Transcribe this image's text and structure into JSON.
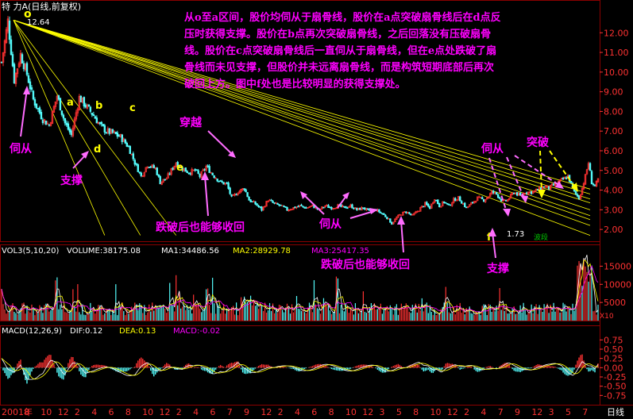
{
  "header": {
    "title": "特 力A(日线,前复权)",
    "high_label": "12.64",
    "low_label": "1.73",
    "signal_label": "波段"
  },
  "annotation": {
    "lines": [
      "从o至a区间，股价均伺从于扇骨线，股价在a点突破扇骨线后在d点反",
      "压时获得支撑。股价在b点再次突破扇骨线，之后回落没有压破扇骨",
      "线。股价在c点突破扇骨线后一直伺从于扇骨线，但在e点处跌破了扇",
      "骨线而未见支撑，但股价并未远离扇骨线，而是构筑短期底部后再次",
      "破回上方。图中f处也是比较明显的获得支撑处。"
    ]
  },
  "callouts": {
    "o": "o",
    "a": "a",
    "b": "b",
    "c": "c",
    "d": "d",
    "e": "e",
    "f": "f",
    "follow1": "伺从",
    "support1": "支撑",
    "cross": "穿越",
    "recover1": "跌破后也能够收回",
    "follow2": "伺从",
    "recover2": "跌破后也能够收回",
    "follow3": "伺从",
    "breakout": "突破",
    "support2": "支撑"
  },
  "colors": {
    "up": "#ff3232",
    "down": "#54fcfc",
    "fan": "#ffff00",
    "grid": "#8b0000",
    "axis_text": "#ff3232",
    "magenta": "#ff00ff",
    "yellow_text": "#ffff00",
    "dif": "#ffffff",
    "dea": "#ffff00",
    "ma1": "#ffffff",
    "ma2": "#ffff00",
    "ma3": "#ff00ff",
    "vol_bar": "#9a9a9a"
  },
  "indicators": {
    "vol": {
      "label": "VOL3(5,10,20)",
      "volume": "VOLUME:38175.08",
      "ma1": "MA1:34486.56",
      "ma2": "MA2:28929.78",
      "ma3": "MA3:25417.35",
      "unit": "X10"
    },
    "macd": {
      "label": "MACD(12,26,9)",
      "dif": "DIF:0.12",
      "dea": "DEA:0.13",
      "macd": "MACD:-0.02"
    }
  },
  "chart_data": [
    {
      "type": "candlestick",
      "title": "特 力A(日线,前复权)",
      "ylim": [
        1.4,
        13.1
      ],
      "yticks": [
        2.0,
        3.0,
        4.0,
        5.0,
        6.0,
        7.0,
        8.0,
        9.0,
        10.0,
        11.0,
        12.0
      ],
      "ytick_labels": [
        "2.00",
        "3.00",
        "4.00",
        "5.00",
        "6.00",
        "7.00",
        "8.00",
        "9.00",
        "10.00",
        "11.00",
        "12.00"
      ],
      "x_bars": 370,
      "close_path": [
        [
          0,
          10.5
        ],
        [
          8,
          12.6
        ],
        [
          16,
          9.6
        ],
        [
          24,
          10.9
        ],
        [
          32,
          9.9
        ],
        [
          40,
          8.6
        ],
        [
          52,
          7.6
        ],
        [
          60,
          7.3
        ],
        [
          70,
          8.8
        ],
        [
          80,
          7.4
        ],
        [
          88,
          6.8
        ],
        [
          98,
          8.7
        ],
        [
          108,
          8.2
        ],
        [
          116,
          7.8
        ],
        [
          124,
          7.3
        ],
        [
          132,
          7.0
        ],
        [
          140,
          6.9
        ],
        [
          150,
          6.7
        ],
        [
          160,
          6.2
        ],
        [
          168,
          5.4
        ],
        [
          176,
          4.7
        ],
        [
          184,
          5.3
        ],
        [
          194,
          5.1
        ],
        [
          200,
          4.4
        ],
        [
          208,
          4.6
        ],
        [
          220,
          5.4
        ],
        [
          228,
          5.1
        ],
        [
          236,
          4.9
        ],
        [
          244,
          5.0
        ],
        [
          250,
          4.7
        ],
        [
          258,
          5.2
        ],
        [
          266,
          4.8
        ],
        [
          276,
          4.4
        ],
        [
          284,
          4.3
        ],
        [
          290,
          3.6
        ],
        [
          298,
          3.9
        ],
        [
          306,
          4.1
        ],
        [
          312,
          3.5
        ],
        [
          320,
          3.3
        ],
        [
          328,
          3.0
        ],
        [
          336,
          3.5
        ],
        [
          344,
          3.3
        ],
        [
          352,
          3.2
        ],
        [
          360,
          3.0
        ],
        [
          368,
          3.1
        ],
        [
          376,
          3.2
        ],
        [
          384,
          3.1
        ],
        [
          392,
          3.2
        ],
        [
          400,
          3.0
        ],
        [
          408,
          3.2
        ],
        [
          416,
          3.1
        ],
        [
          424,
          3.2
        ],
        [
          432,
          3.1
        ],
        [
          440,
          3.2
        ],
        [
          448,
          3.0
        ],
        [
          456,
          3.1
        ],
        [
          464,
          2.9
        ],
        [
          472,
          3.0
        ],
        [
          480,
          2.8
        ],
        [
          486,
          2.6
        ],
        [
          492,
          2.3
        ],
        [
          498,
          2.6
        ],
        [
          504,
          2.8
        ],
        [
          510,
          2.9
        ],
        [
          518,
          2.7
        ],
        [
          526,
          3.0
        ],
        [
          534,
          3.3
        ],
        [
          540,
          3.1
        ],
        [
          546,
          3.6
        ],
        [
          552,
          3.2
        ],
        [
          558,
          3.4
        ],
        [
          564,
          3.2
        ],
        [
          570,
          3.5
        ],
        [
          576,
          3.6
        ],
        [
          580,
          3.4
        ],
        [
          586,
          3.1
        ],
        [
          592,
          3.3
        ],
        [
          600,
          3.6
        ],
        [
          608,
          3.5
        ],
        [
          614,
          3.7
        ],
        [
          618,
          3.9
        ],
        [
          624,
          3.8
        ],
        [
          632,
          3.4
        ],
        [
          638,
          3.5
        ],
        [
          646,
          3.9
        ],
        [
          654,
          3.7
        ],
        [
          660,
          3.9
        ],
        [
          668,
          3.9
        ],
        [
          676,
          4.0
        ],
        [
          684,
          4.2
        ],
        [
          690,
          4.1
        ],
        [
          698,
          4.3
        ],
        [
          706,
          4.5
        ],
        [
          714,
          4.7
        ],
        [
          722,
          3.9
        ],
        [
          728,
          3.6
        ],
        [
          732,
          4.1
        ],
        [
          736,
          4.7
        ],
        [
          740,
          5.4
        ],
        [
          744,
          4.4
        ],
        [
          748,
          4.2
        ],
        [
          752,
          4.5
        ]
      ],
      "fan_lines": {
        "origin": {
          "bar": 15,
          "price": 12.64
        },
        "end_prices_at_right_edge": [
          1.7,
          2.2,
          2.5,
          2.7,
          3.0,
          3.35,
          3.55,
          3.8,
          4.05
        ],
        "steep_end_prices_at_bar_220": [
          1.7,
          1.7,
          1.7
        ]
      },
      "marked_points": {
        "high": 12.64,
        "low": 1.73
      }
    },
    {
      "type": "bar",
      "title": "VOL3(5,10,20)",
      "ylim": [
        0,
        17500
      ],
      "yticks": [
        5000,
        10000,
        15000
      ],
      "ytick_labels": [
        "5000",
        "10000",
        "15000"
      ],
      "series": [
        {
          "name": "VOLUME",
          "last": 38175.08
        },
        {
          "name": "MA1",
          "last": 34486.56
        },
        {
          "name": "MA2",
          "last": 28929.78
        },
        {
          "name": "MA3",
          "last": 25417.35
        }
      ]
    },
    {
      "type": "line",
      "title": "MACD(12,26,9)",
      "ylim": [
        -1.0,
        0.8
      ],
      "yticks": [
        -0.75,
        -0.5,
        -0.25,
        0.0,
        0.25,
        0.5,
        0.75
      ],
      "ytick_labels": [
        "-0.75",
        "-0.50",
        "-0.25",
        "0.00",
        "0.25",
        "0.50",
        "0.75"
      ],
      "series": [
        {
          "name": "DIF",
          "last": 0.12
        },
        {
          "name": "DEA",
          "last": 0.13
        },
        {
          "name": "MACD",
          "last": -0.02
        }
      ]
    }
  ],
  "x_axis": {
    "labels": [
      "2001年",
      "8",
      "10",
      "12",
      "2",
      "4",
      "6",
      "8",
      "10",
      "12",
      "2",
      "4",
      "6",
      "7",
      "9",
      "12",
      "2",
      "4",
      "6",
      "8",
      "10",
      "12",
      "3",
      "5",
      "8",
      "10",
      "12",
      "2",
      "4",
      "7",
      "9",
      "12",
      "3",
      "5",
      "7"
    ],
    "unit": "日线"
  }
}
